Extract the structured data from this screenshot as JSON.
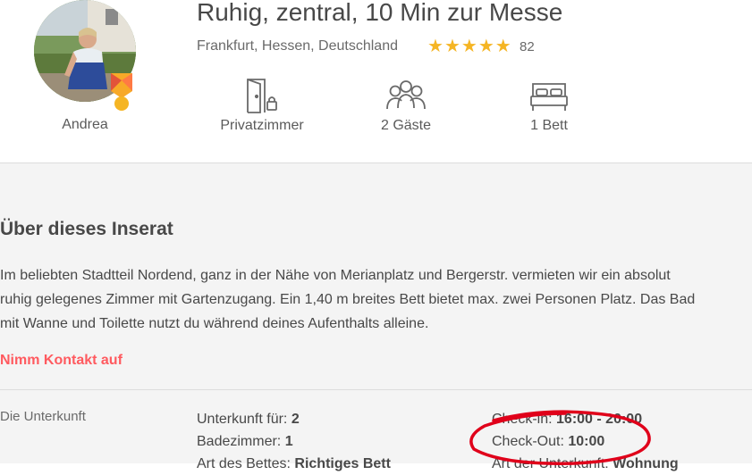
{
  "listing": {
    "title": "Ruhig, zentral, 10 Min zur Messe",
    "location": "Frankfurt, Hessen, Deutschland",
    "rating_stars": 5,
    "review_count": "82",
    "star_color": "#f5b524"
  },
  "host": {
    "name": "Andrea"
  },
  "features": [
    {
      "label": "Privatzimmer",
      "icon": "door-lock-icon"
    },
    {
      "label": "2 Gäste",
      "icon": "guests-icon"
    },
    {
      "label": "1 Bett",
      "icon": "bed-icon"
    }
  ],
  "about": {
    "heading": "Über dieses Inserat",
    "lines": [
      "Im beliebten Stadtteil Nordend, ganz in der Nähe von Merianplatz und Bergerstr. vermieten wir ein absolut",
      "ruhig gelegenes Zimmer mit Gartenzugang. Ein 1,40 m breites Bett bietet max. zwei Personen Platz. Das Bad",
      "mit Wanne und Toilette nutzt du während deines Aufenthalts alleine."
    ],
    "contact_label": "Nimm Kontakt auf",
    "accent_color": "#ff5a5f"
  },
  "space": {
    "label": "Die Unterkunft",
    "left": [
      {
        "key": "Unterkunft für: ",
        "value": "2"
      },
      {
        "key": "Badezimmer: ",
        "value": "1"
      },
      {
        "key": "Art des Bettes: ",
        "value": "Richtiges Bett"
      }
    ],
    "right": [
      {
        "key": "Check-in: ",
        "value": "16:00 - 20:00"
      },
      {
        "key": "Check-Out: ",
        "value": "10:00"
      },
      {
        "key": "Art der Unterkunft: ",
        "value": "Wohnung"
      }
    ]
  },
  "annotation": {
    "color": "#e0001a"
  }
}
